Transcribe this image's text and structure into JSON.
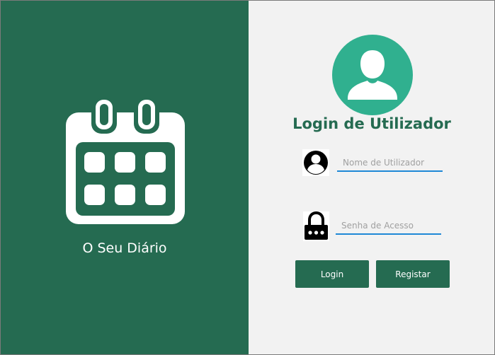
{
  "app": {
    "name": "O Seu Diário"
  },
  "login": {
    "title": "Login de Utilizador",
    "username_placeholder": "Nome de Utilizador",
    "username_value": "",
    "password_placeholder": "Senha de Acesso",
    "password_value": ""
  },
  "buttons": {
    "login_label": "Login",
    "register_label": "Registar"
  },
  "colors": {
    "primary_green": "#256b51",
    "avatar_green": "#30b08f",
    "field_underline": "#1e88d6",
    "background": "#f2f2f2"
  },
  "icons": {
    "left": "calendar-icon",
    "avatar": "user-avatar-icon",
    "username": "user-icon",
    "password": "lock-icon"
  }
}
